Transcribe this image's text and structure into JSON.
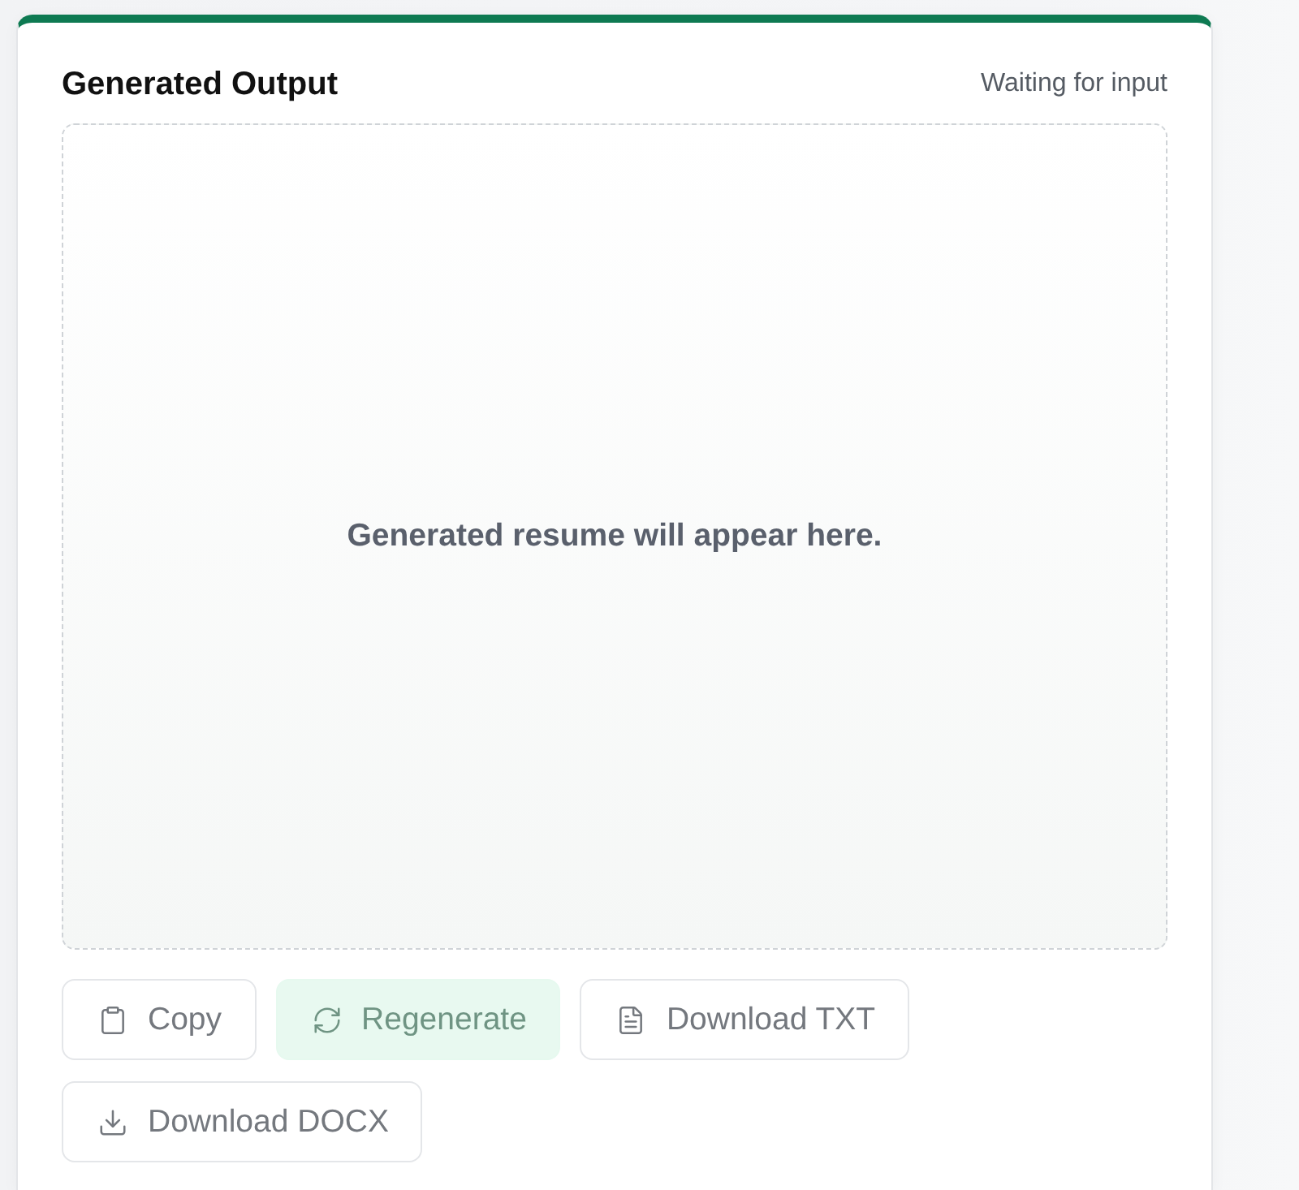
{
  "panel": {
    "title": "Generated Output",
    "status": "Waiting for input"
  },
  "output": {
    "empty_message": "Generated resume will appear here."
  },
  "actions": [
    {
      "label": "Copy",
      "kind": "secondary",
      "disabled": true
    },
    {
      "label": "Regenerate",
      "kind": "primary",
      "disabled": true
    },
    {
      "label": "Download TXT",
      "kind": "secondary",
      "disabled": true
    },
    {
      "label": "Download DOCX",
      "kind": "secondary",
      "disabled": true
    }
  ]
}
